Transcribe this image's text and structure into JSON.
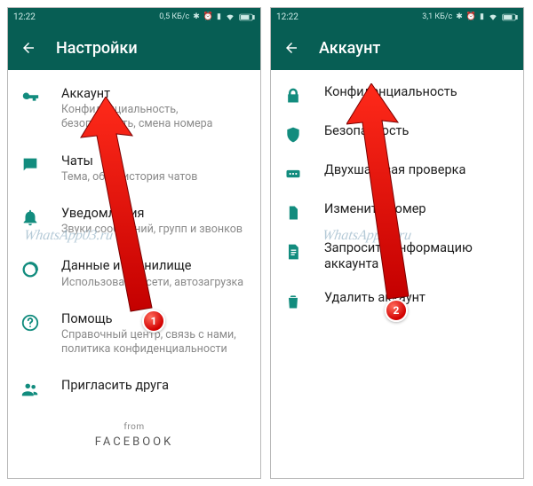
{
  "left": {
    "status": {
      "time": "12:22",
      "net": "0,5 КБ/с"
    },
    "appbar_title": "Настройки",
    "items": [
      {
        "title": "Аккаунт",
        "subtitle": "Конфиденциальность, безопасность, смена номера"
      },
      {
        "title": "Чаты",
        "subtitle": "Тема, обои, история чатов"
      },
      {
        "title": "Уведомления",
        "subtitle": "Звуки сообщений, групп и звонков"
      },
      {
        "title": "Данные и хранилище",
        "subtitle": "Использование сети, автозагрузка"
      },
      {
        "title": "Помощь",
        "subtitle": "Справочный центр, связь с нами, политика конфиденциальности"
      },
      {
        "title": "Пригласить друга",
        "subtitle": ""
      }
    ],
    "footer_from": "from",
    "footer_brand": "FACEBOOK",
    "badge": "1",
    "watermark": "WhatsApp03.ru"
  },
  "right": {
    "status": {
      "time": "12:22",
      "net": "3,1 КБ/с"
    },
    "appbar_title": "Аккаунт",
    "items": [
      {
        "title": "Конфиденциальность"
      },
      {
        "title": "Безопасность"
      },
      {
        "title": "Двухшаговая проверка"
      },
      {
        "title": "Изменить номер"
      },
      {
        "title": "Запросить информацию аккаунта"
      },
      {
        "title": "Удалить аккаунт"
      }
    ],
    "badge": "2",
    "watermark": "WhatsApp03.ru"
  }
}
